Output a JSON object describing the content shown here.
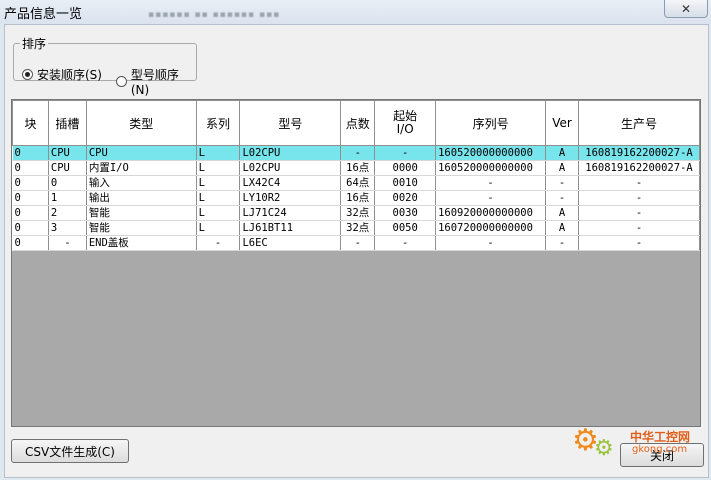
{
  "window": {
    "title": "产品信息一览",
    "ghost_text": "▪▪▪▪▪▪ ▪▪ ▪▪▪▪▪▪ ▪▪▪",
    "close_glyph": "✕"
  },
  "sort": {
    "legend": "排序",
    "options": [
      {
        "label": "安装顺序(S)",
        "selected": true
      },
      {
        "label": "型号顺序(N)",
        "selected": false
      }
    ]
  },
  "table": {
    "headers": [
      "块",
      "插槽",
      "类型",
      "系列",
      "型号",
      "点数",
      "起始\nI/O",
      "序列号",
      "Ver",
      "生产号"
    ],
    "rows": [
      [
        "0",
        "CPU",
        "CPU",
        "L",
        "L02CPU",
        "-",
        "-",
        "160520000000000",
        "A",
        "160819162200027-A"
      ],
      [
        "0",
        "CPU",
        "内置I/O",
        "L",
        "L02CPU",
        "16点",
        "0000",
        "160520000000000",
        "A",
        "160819162200027-A"
      ],
      [
        "0",
        "0",
        "输入",
        "L",
        "LX42C4",
        "64点",
        "0010",
        "-",
        "-",
        "-"
      ],
      [
        "0",
        "1",
        "输出",
        "L",
        "LY10R2",
        "16点",
        "0020",
        "-",
        "-",
        "-"
      ],
      [
        "0",
        "2",
        "智能",
        "L",
        "LJ71C24",
        "32点",
        "0030",
        "160920000000000",
        "A",
        "-"
      ],
      [
        "0",
        "3",
        "智能",
        "L",
        "LJ61BT11",
        "32点",
        "0050",
        "160720000000000",
        "A",
        "-"
      ],
      [
        "0",
        "-",
        "END盖板",
        "-",
        "L6EC",
        "-",
        "-",
        "-",
        "-",
        "-"
      ]
    ],
    "selected_row": 0
  },
  "buttons": {
    "csv": "CSV文件生成(C)",
    "close": "关闭"
  },
  "watermark": {
    "text": "中华工控网",
    "site": "gkong.com"
  },
  "colors": {
    "selection": "#78e4ec",
    "empty_area": "#a9a9a9"
  }
}
